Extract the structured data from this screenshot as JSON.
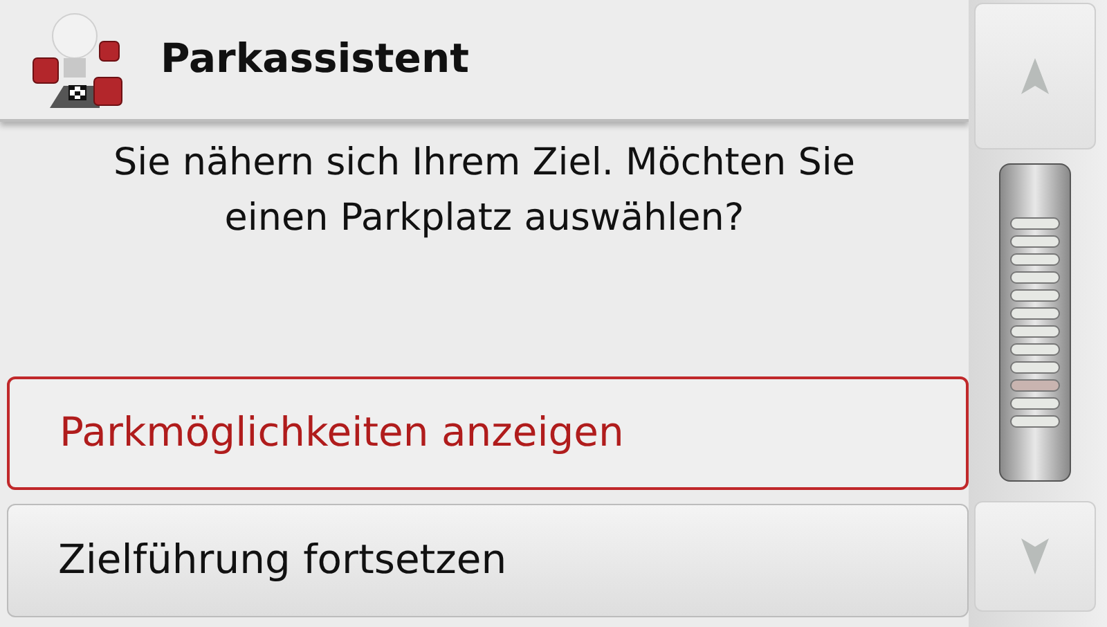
{
  "header": {
    "title": "Parkassistent"
  },
  "message": "Sie nähern sich Ihrem Ziel. Möchten Sie einen Parkplatz auswählen?",
  "options": [
    {
      "label": "Parkmöglichkeiten anzeigen",
      "selected": true
    },
    {
      "label": "Zielführung fortsetzen",
      "selected": false
    }
  ]
}
